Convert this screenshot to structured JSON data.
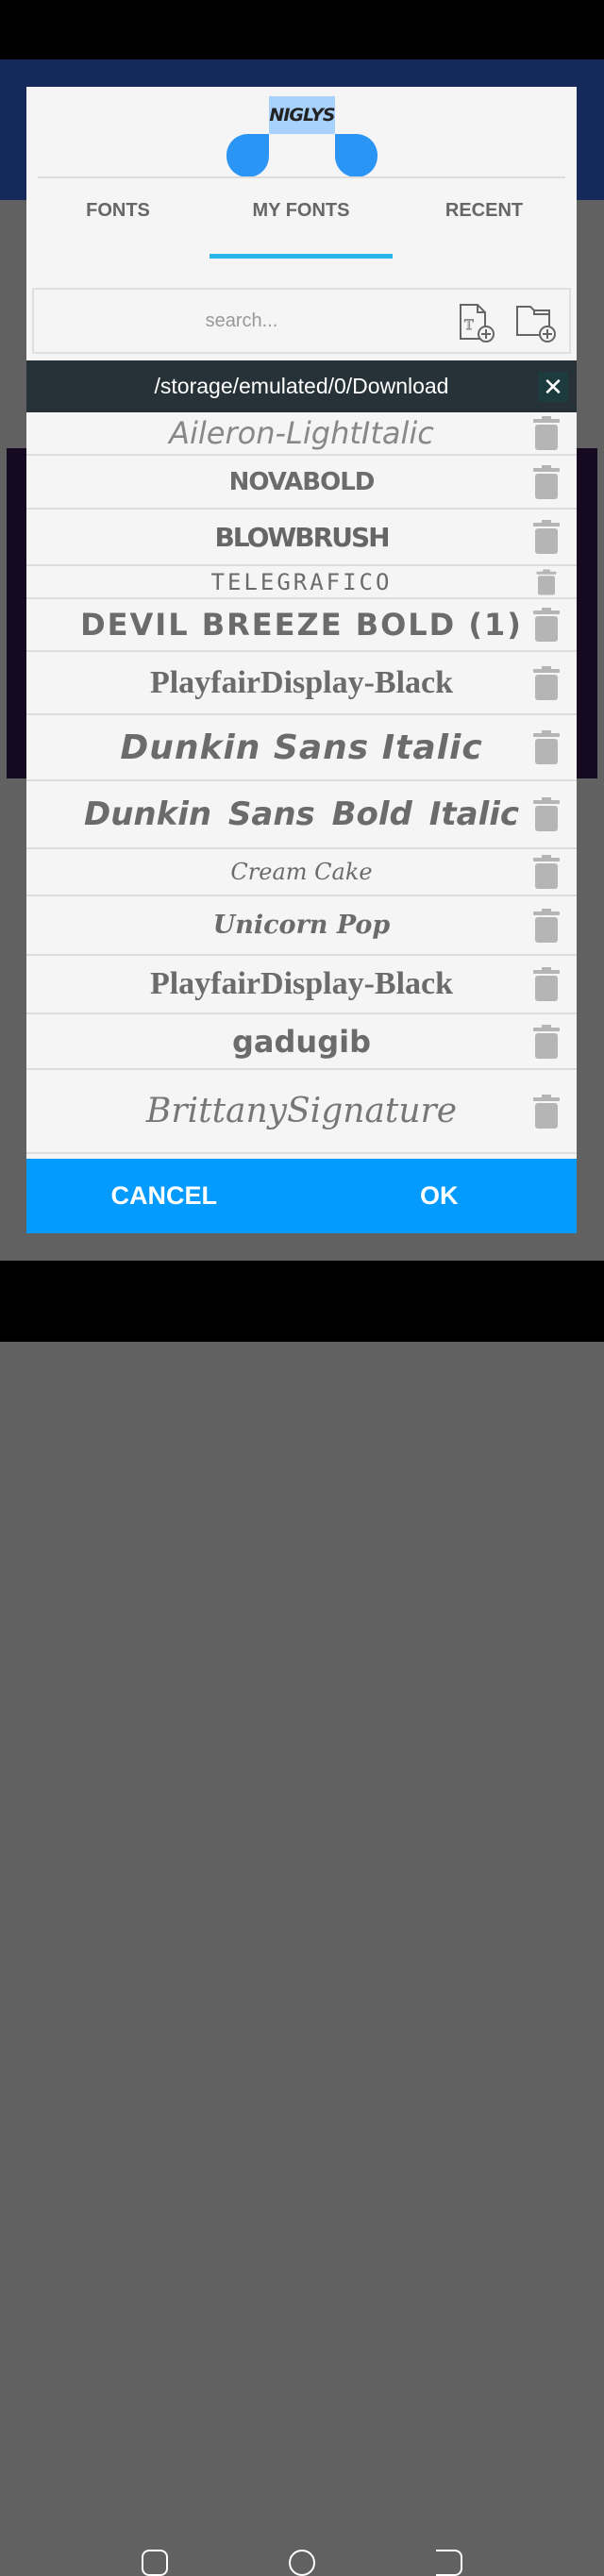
{
  "dialog": {
    "logo_text": "NIGLYS",
    "tabs": [
      {
        "label": "FONTS"
      },
      {
        "label": "MY FONTS"
      },
      {
        "label": "RECENT"
      }
    ],
    "active_tab": "MY FONTS",
    "search": {
      "placeholder": "search...",
      "value": ""
    },
    "path": "/storage/emulated/0/Download",
    "fonts": [
      {
        "name": "Aileron-LightItalic"
      },
      {
        "name": "NOVABOLD"
      },
      {
        "name": "BLOWBRUSH"
      },
      {
        "name": "TELEGRAFICO"
      },
      {
        "name": "DEVIL BREEZE BOLD (1)"
      },
      {
        "name": "PlayfairDisplay-Black"
      },
      {
        "name": "Dunkin Sans Italic"
      },
      {
        "name": "Dunkin Sans Bold Italic"
      },
      {
        "name": "Cream Cake"
      },
      {
        "name": "Unicorn Pop"
      },
      {
        "name": "PlayfairDisplay-Black"
      },
      {
        "name": "gadugib"
      },
      {
        "name": "BrittanySignature"
      }
    ],
    "cancel_label": "CANCEL",
    "ok_label": "OK"
  },
  "colors": {
    "accent": "#039bfd",
    "tab_indicator": "#2ab5e8",
    "path_bar": "#263238"
  }
}
